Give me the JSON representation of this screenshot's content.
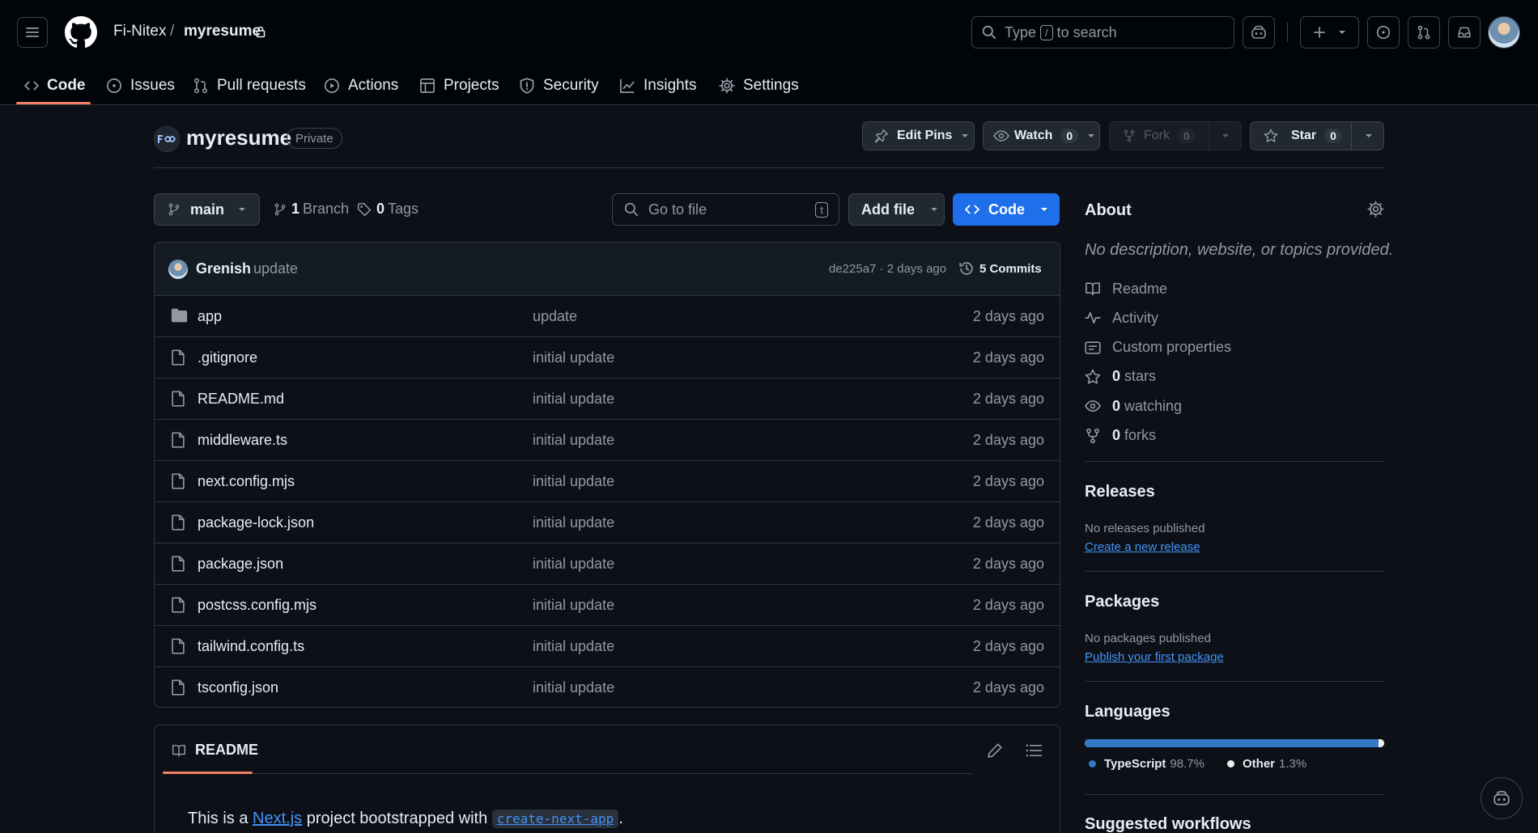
{
  "header": {
    "owner": "Fi-Nitex",
    "separator": "/",
    "repo": "myresume",
    "search_prefix": "Type",
    "search_key": "/",
    "search_suffix": "to search"
  },
  "tabs": [
    {
      "label": "Code",
      "icon": "code-icon"
    },
    {
      "label": "Issues",
      "icon": "issue-icon"
    },
    {
      "label": "Pull requests",
      "icon": "pull-request-icon"
    },
    {
      "label": "Actions",
      "icon": "play-icon"
    },
    {
      "label": "Projects",
      "icon": "table-icon"
    },
    {
      "label": "Security",
      "icon": "shield-icon"
    },
    {
      "label": "Insights",
      "icon": "graph-icon"
    },
    {
      "label": "Settings",
      "icon": "gear-icon"
    }
  ],
  "repo_bar": {
    "name": "myresume",
    "visibility": "Private",
    "edit_pins": "Edit Pins",
    "watch_label": "Watch",
    "watch_count": "0",
    "fork_label": "Fork",
    "fork_count": "0",
    "star_label": "Star",
    "star_count": "0"
  },
  "branch_row": {
    "branch": "main",
    "branch_count": "1",
    "branch_label": "Branch",
    "tag_count": "0",
    "tag_label": "Tags",
    "goto_placeholder": "Go to file",
    "goto_key": "t",
    "add_file": "Add file",
    "code": "Code"
  },
  "commit": {
    "author": "Grenish",
    "message": "update",
    "hash_time": "de225a7 · 2 days ago",
    "commits": "5 Commits"
  },
  "files": [
    {
      "name": "app",
      "type": "folder",
      "message": "update",
      "date": "2 days ago"
    },
    {
      "name": ".gitignore",
      "type": "file",
      "message": "initial update",
      "date": "2 days ago"
    },
    {
      "name": "README.md",
      "type": "file",
      "message": "initial update",
      "date": "2 days ago"
    },
    {
      "name": "middleware.ts",
      "type": "file",
      "message": "initial update",
      "date": "2 days ago"
    },
    {
      "name": "next.config.mjs",
      "type": "file",
      "message": "initial update",
      "date": "2 days ago"
    },
    {
      "name": "package-lock.json",
      "type": "file",
      "message": "initial update",
      "date": "2 days ago"
    },
    {
      "name": "package.json",
      "type": "file",
      "message": "initial update",
      "date": "2 days ago"
    },
    {
      "name": "postcss.config.mjs",
      "type": "file",
      "message": "initial update",
      "date": "2 days ago"
    },
    {
      "name": "tailwind.config.ts",
      "type": "file",
      "message": "initial update",
      "date": "2 days ago"
    },
    {
      "name": "tsconfig.json",
      "type": "file",
      "message": "initial update",
      "date": "2 days ago"
    }
  ],
  "readme": {
    "tab": "README",
    "text_before": "This is a",
    "link": "Next.js",
    "text_middle": "project bootstrapped with",
    "code": "create-next-app",
    "text_after": "."
  },
  "about": {
    "title": "About",
    "description": "No description, website, or topics provided.",
    "items": [
      {
        "icon": "book-icon",
        "bold": "",
        "label": "Readme"
      },
      {
        "icon": "pulse-icon",
        "bold": "",
        "label": "Activity"
      },
      {
        "icon": "note-icon",
        "bold": "",
        "label": "Custom properties"
      },
      {
        "icon": "star-icon",
        "bold": "0",
        "label": "stars"
      },
      {
        "icon": "eye-icon",
        "bold": "0",
        "label": "watching"
      },
      {
        "icon": "fork-icon",
        "bold": "0",
        "label": "forks"
      }
    ]
  },
  "releases": {
    "title": "Releases",
    "status": "No releases published",
    "link": "Create a new release"
  },
  "packages": {
    "title": "Packages",
    "status": "No packages published",
    "link": "Publish your first package"
  },
  "languages": {
    "title": "Languages",
    "items": [
      {
        "name": "TypeScript",
        "percent": "98.7%",
        "value": 98.7,
        "color": "#3178c6"
      },
      {
        "name": "Other",
        "percent": "1.3%",
        "value": 1.3,
        "color": "#ededed"
      }
    ]
  },
  "workflows": {
    "title": "Suggested workflows"
  },
  "colors": {
    "accent": "#1f6feb",
    "link": "#4493f8",
    "tab_underline": "#f78166"
  }
}
